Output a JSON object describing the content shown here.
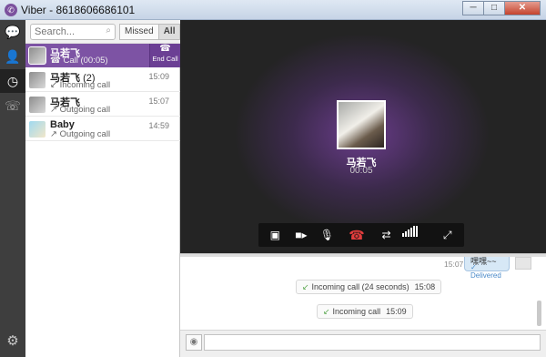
{
  "window": {
    "title": "Viber - 8618606686101",
    "icon": "viber-logo-icon"
  },
  "window_controls": [
    "─",
    "□",
    "✕"
  ],
  "nav": [
    {
      "name": "chats",
      "icon": "chat-bubbles-icon"
    },
    {
      "name": "contacts",
      "icon": "person-icon"
    },
    {
      "name": "recent",
      "icon": "clock-icon",
      "active": true
    },
    {
      "name": "dialpad",
      "icon": "phone-keypad-icon"
    }
  ],
  "search": {
    "placeholder": "Search..."
  },
  "filter": {
    "missed": "Missed",
    "all": "All",
    "selected": "All"
  },
  "recents": [
    {
      "name": "马若飞",
      "count": "",
      "sub": "Call (00:05)",
      "time": "",
      "active": true,
      "end_call_label": "End Call"
    },
    {
      "name": "马若飞",
      "count": "(2)",
      "sub": "Incoming call",
      "time": "15:09"
    },
    {
      "name": "马若飞",
      "count": "",
      "sub": "Outgoing call",
      "time": "15:07"
    },
    {
      "name": "Baby",
      "count": "",
      "sub": "Outgoing call",
      "time": "14:59"
    }
  ],
  "call": {
    "name": "马若飞",
    "duration": "00:05"
  },
  "chat": {
    "bubble": {
      "time": "15:07",
      "text": "嘿嘿~~",
      "status": "Delivered"
    },
    "events": [
      {
        "text": "Incoming call (24 seconds)",
        "time": "15:08"
      },
      {
        "text": "Incoming call",
        "time": "15:09"
      }
    ]
  },
  "colors": {
    "accent": "#7d53a4",
    "hangup": "#e23d3d",
    "nav_bg": "#3e3e3e"
  }
}
